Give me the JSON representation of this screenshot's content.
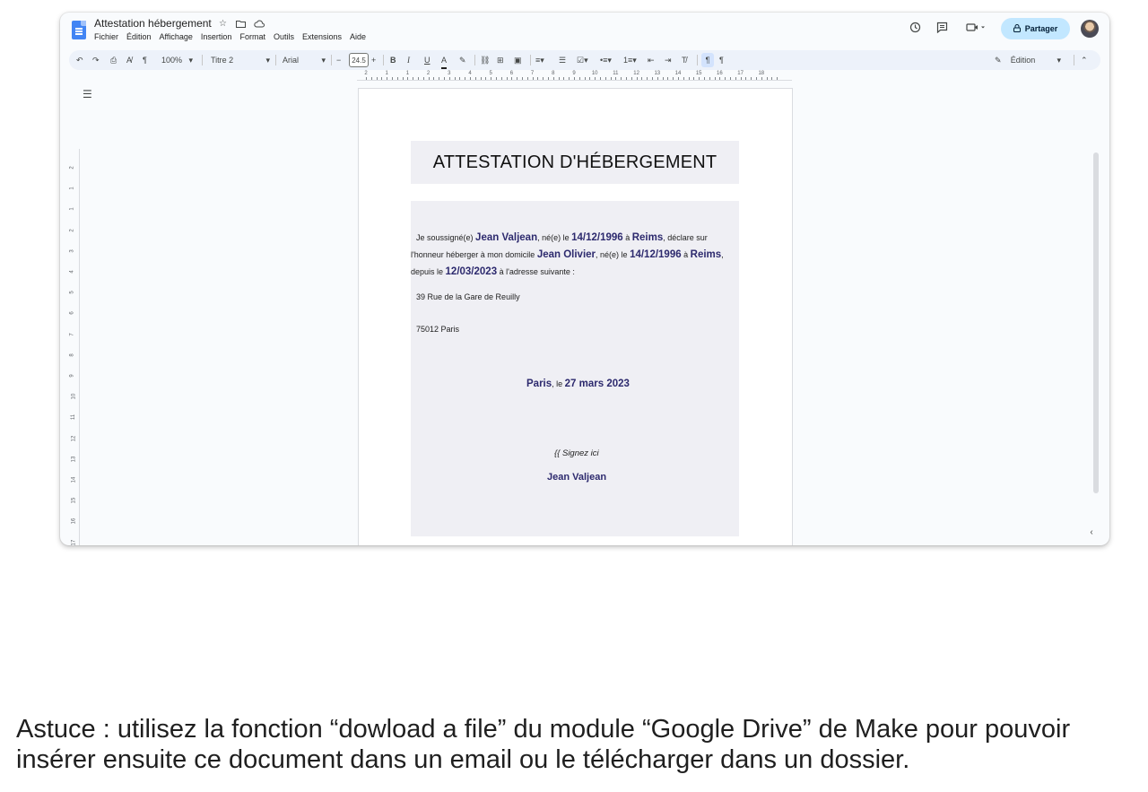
{
  "app": {
    "doc_title": "Attestation hébergement",
    "menu": [
      "Fichier",
      "Édition",
      "Affichage",
      "Insertion",
      "Format",
      "Outils",
      "Extensions",
      "Aide"
    ],
    "share_label": "Partager",
    "mode_label": "Édition"
  },
  "toolbar": {
    "zoom": "100%",
    "style": "Titre 2",
    "font": "Arial",
    "font_size": "24.5",
    "minus": "−",
    "plus": "+"
  },
  "ruler": {
    "numbers": [
      "2",
      "1",
      "1",
      "2",
      "3",
      "4",
      "5",
      "6",
      "7",
      "8",
      "9",
      "10",
      "11",
      "12",
      "13",
      "14",
      "15",
      "16",
      "17",
      "18"
    ],
    "vnumbers": [
      "2",
      "1",
      "1",
      "2",
      "3",
      "4",
      "5",
      "6",
      "7",
      "8",
      "9",
      "10",
      "11",
      "12",
      "13",
      "14",
      "15",
      "16",
      "17",
      "18",
      "19"
    ]
  },
  "document": {
    "heading": "ATTESTATION D'HÉBERGEMENT",
    "l1_a": "Je soussigné(e) ",
    "l1_name": "Jean Valjean",
    "l1_b": ", né(e) le ",
    "l1_date": "14/12/1996",
    "l1_c": " à ",
    "l1_city": "Reims",
    "l1_d": ", déclare sur",
    "l2_a": "l'honneur héberger à mon domicile ",
    "l2_name": "Jean Olivier",
    "l2_b": ", né(e) le ",
    "l2_date": "14/12/1996",
    "l2_c": " à ",
    "l2_city": "Reims",
    "l2_d": ",",
    "l3_a": "depuis le ",
    "l3_date": "12/03/2023",
    "l3_b": " à l'adresse suivante :",
    "address_street": "39 Rue de la Gare de Reuilly",
    "address_city": "75012 Paris",
    "place": "Paris",
    "place_sep": ", le ",
    "date": "27 mars 2023",
    "signature_placeholder": "{{ Signez ici",
    "signature_name": "Jean Valjean"
  },
  "caption": "Astuce : utilisez la fonction “dowload a file” du module “Google Drive” de Make pour pouvoir insérer ensuite ce document dans un email ou le télécharger dans un dossier.",
  "colors": {
    "accent": "#4285f4",
    "share_bg": "#c2e7ff",
    "highlight_text": "#2d2a6e",
    "box_bg": "#efeff4"
  }
}
